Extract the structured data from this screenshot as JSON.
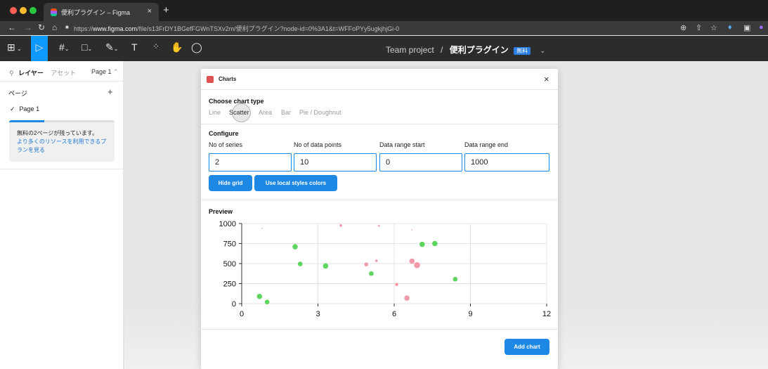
{
  "browser": {
    "tab_title": "便利プラグイン – Figma",
    "tab_close": "×",
    "new_tab": "+",
    "url_prefix": "https://",
    "url_domain": "www.figma.com",
    "url_path": "/file/s13FrDY1BGefFGWnTSXv2m/便利プラグイン?node-id=0%3A1&t=WFFoPYy5ugkjhjGi-0",
    "nav_icons": [
      "back-arrow-icon",
      "forward-arrow-icon",
      "reload-icon",
      "home-icon"
    ]
  },
  "figma": {
    "project": "Team project",
    "separator": "/",
    "file_name": "便利プラグイン",
    "plan_badge": "無料"
  },
  "layers_panel": {
    "tab_layers": "レイヤー",
    "tab_assets": "アセット",
    "page_selector": "Page 1",
    "pages_heading": "ページ",
    "add_page": "+",
    "current_page": "Page 1",
    "notice_text": "無料の2ページが残っています。",
    "notice_link": "より多くのリソースを利用できるプランを見る"
  },
  "plugin": {
    "title": "Charts",
    "close": "×",
    "choose_heading": "Choose chart type",
    "chart_types": [
      "Line",
      "Scatter",
      "Area",
      "Bar",
      "Pie / Doughnut"
    ],
    "selected_type": "Scatter",
    "configure_heading": "Configure",
    "fields": [
      {
        "label": "No of series",
        "value": "2"
      },
      {
        "label": "No of data points",
        "value": "10"
      },
      {
        "label": "Data range start",
        "value": "0"
      },
      {
        "label": "Data range end",
        "value": "1000"
      }
    ],
    "hide_grid_button": "Hide grid",
    "local_styles_button": "Use local styles colors",
    "preview_heading": "Preview",
    "add_chart_button": "Add chart"
  },
  "colors": {
    "accent": "#1e88e5",
    "series_green": "#4cd04c",
    "series_pink": "#f08e9e"
  },
  "chart_data": {
    "type": "scatter",
    "xlim": [
      0,
      12
    ],
    "ylim": [
      0,
      1000
    ],
    "x_ticks": [
      "0",
      "3",
      "6",
      "9",
      "12"
    ],
    "y_ticks": [
      "0",
      "250",
      "500",
      "750",
      "1000"
    ],
    "grid": true,
    "series": [
      {
        "color": "#4cd04c",
        "points": [
          [
            0.7,
            90,
            7
          ],
          [
            1.0,
            20,
            6
          ],
          [
            2.1,
            710,
            7
          ],
          [
            2.3,
            495,
            6
          ],
          [
            3.3,
            470,
            7
          ],
          [
            5.1,
            375,
            6
          ],
          [
            7.1,
            740,
            7
          ],
          [
            7.6,
            750,
            7
          ],
          [
            8.4,
            305,
            6
          ]
        ]
      },
      {
        "color": "#f08e9e",
        "points": [
          [
            0.8,
            940,
            1
          ],
          [
            3.9,
            975,
            3
          ],
          [
            4.9,
            490,
            5
          ],
          [
            5.3,
            535,
            3
          ],
          [
            5.4,
            970,
            2
          ],
          [
            6.1,
            240,
            4
          ],
          [
            6.5,
            70,
            7
          ],
          [
            6.7,
            530,
            7
          ],
          [
            6.9,
            480,
            8
          ],
          [
            6.7,
            920,
            1
          ]
        ]
      }
    ]
  }
}
